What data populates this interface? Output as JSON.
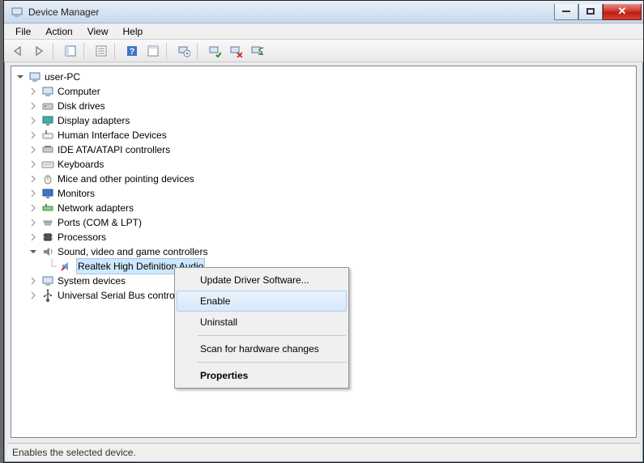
{
  "window": {
    "title": "Device Manager"
  },
  "menu": {
    "file": "File",
    "action": "Action",
    "view": "View",
    "help": "Help"
  },
  "tree": {
    "root": "user-PC",
    "computer": "Computer",
    "disk": "Disk drives",
    "display": "Display adapters",
    "hid": "Human Interface Devices",
    "ide": "IDE ATA/ATAPI controllers",
    "keyboards": "Keyboards",
    "mice": "Mice and other pointing devices",
    "monitors": "Monitors",
    "network": "Network adapters",
    "ports": "Ports (COM & LPT)",
    "processors": "Processors",
    "sound": "Sound, video and game controllers",
    "realtek": "Realtek High Definition Audio",
    "system": "System devices",
    "usb": "Universal Serial Bus controllers"
  },
  "context": {
    "update": "Update Driver Software...",
    "enable": "Enable",
    "uninstall": "Uninstall",
    "scan": "Scan for hardware changes",
    "properties": "Properties"
  },
  "status": "Enables the selected device."
}
